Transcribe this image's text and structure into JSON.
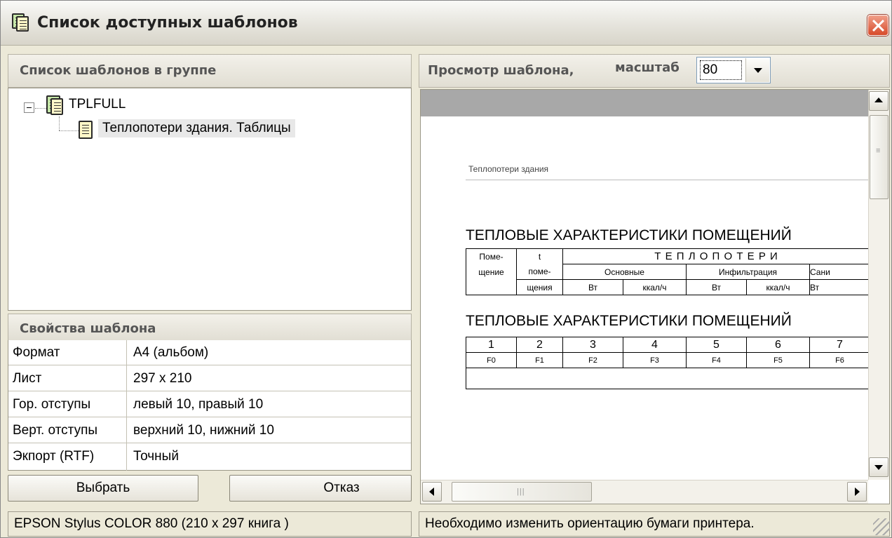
{
  "window": {
    "title": "Список доступных шаблонов"
  },
  "left": {
    "group_header": "Список шаблонов в группе",
    "tree": {
      "root_label": "TPLFULL",
      "child_label": "Теплопотери здания. Таблицы"
    },
    "props_header": "Свойства шаблона",
    "props": [
      {
        "key": "Формат",
        "value": "А4 (альбом)"
      },
      {
        "key": "Лист",
        "value": "297 x 210"
      },
      {
        "key": "Гор. отступы",
        "value": "левый 10,  правый 10"
      },
      {
        "key": "Верт. отступы",
        "value": "верхний 10,  нижний 10"
      },
      {
        "key": "Экпорт (RTF)",
        "value": "Точный"
      }
    ],
    "buttons": {
      "select": "Выбрать",
      "cancel": "Отказ"
    },
    "status": "EPSON Stylus COLOR 880 (210 x 297 книга )"
  },
  "right": {
    "preview_header": "Просмотр шаблона,",
    "zoom_label": "масштаб",
    "zoom_value": "80",
    "status": "Необходимо изменить ориентацию бумаги принтера.",
    "document": {
      "page_header": "Теплопотери здания",
      "table_title_1": "ТЕПЛОВЫЕ ХАРАКТЕРИСТИКИ ПОМЕЩЕНИЙ",
      "table_title_2": "ТЕПЛОВЫЕ ХАРАКТЕРИСТИКИ ПОМЕЩЕНИЙ",
      "head": {
        "room_1": "Поме-",
        "room_2": "щение",
        "t": "t",
        "t_2": "поме-",
        "t_3": "щения",
        "heatloss": "Т Е П Л О П О Т Е Р И",
        "main": "Основные",
        "infiltration": "Инфильтрация",
        "sani": "Сани",
        "vt": "Вт",
        "kcal": "ккал/ч"
      },
      "numbers": [
        "1",
        "2",
        "3",
        "4",
        "5",
        "6",
        "7"
      ],
      "fields": [
        "F0",
        "F1",
        "F2",
        "F3",
        "F4",
        "F5",
        "F6"
      ]
    }
  }
}
